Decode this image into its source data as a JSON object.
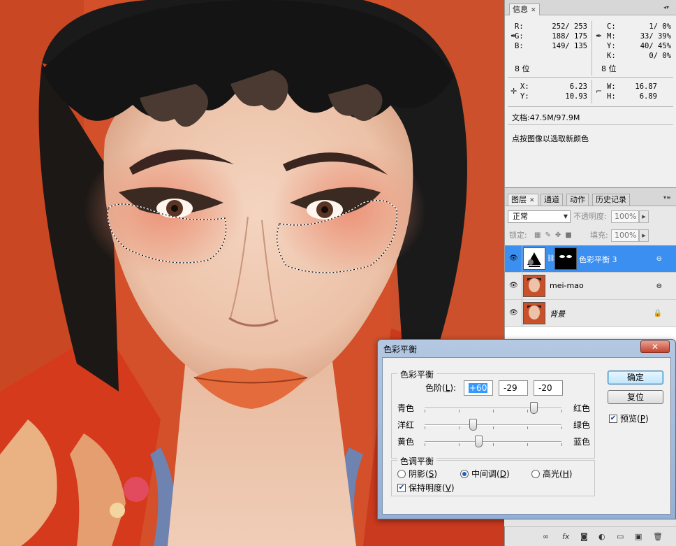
{
  "info_panel": {
    "tab_label": "信息",
    "rgb": {
      "r_label": "R:",
      "r_value": "252/ 253",
      "g_label": "G:",
      "g_value": "188/ 175",
      "b_label": "B:",
      "b_value": "149/ 135",
      "bits": "8 位"
    },
    "cmyk": {
      "c_label": "C:",
      "c_value": "1/ 0%",
      "m_label": "M:",
      "m_value": "33/ 39%",
      "y_label": "Y:",
      "y_value": "40/ 45%",
      "k_label": "K:",
      "k_value": "0/ 0%",
      "bits": "8 位"
    },
    "xy": {
      "x_label": "X:",
      "x_value": "6.23",
      "y_label": "Y:",
      "y_value": "10.93"
    },
    "wh": {
      "w_label": "W:",
      "w_value": "16.87",
      "h_label": "H:",
      "h_value": "6.89"
    },
    "doc": "文档:47.5M/97.9M",
    "hint": "点按图像以选取新颜色"
  },
  "layers_panel": {
    "tabs": [
      "图层",
      "通道",
      "动作",
      "历史记录"
    ],
    "blend_mode": "正常",
    "opacity_label": "不透明度:",
    "opacity_value": "100%",
    "lock_label": "锁定:",
    "fill_label": "填充:",
    "fill_value": "100%",
    "layers": [
      {
        "name": "色彩平衡 3",
        "selected": true
      },
      {
        "name": "mei-mao",
        "selected": false
      },
      {
        "name": "背景",
        "selected": false
      }
    ]
  },
  "dialog": {
    "title": "色彩平衡",
    "close": "✕",
    "balance_group": "色彩平衡",
    "levels_label_a": "色阶(",
    "levels_key": "L",
    "levels_label_b": "):",
    "levels": [
      "+60",
      "-29",
      "-20"
    ],
    "sliders": [
      {
        "left": "青色",
        "right": "红色",
        "value": 60
      },
      {
        "left": "洋红",
        "right": "绿色",
        "value": -29
      },
      {
        "left": "黄色",
        "right": "蓝色",
        "value": -20
      }
    ],
    "tone_group": "色调平衡",
    "shadows_a": "阴影(",
    "shadows_key": "S",
    "shadows_b": ")",
    "midtones_a": "中间调(",
    "midtones_key": "D",
    "midtones_b": ")",
    "highlights_a": "高光(",
    "highlights_key": "H",
    "highlights_b": ")",
    "preserve_a": "保持明度(",
    "preserve_key": "V",
    "preserve_b": ")",
    "ok": "确定",
    "reset": "复位",
    "preview_a": "预览(",
    "preview_key": "P",
    "preview_b": ")",
    "tone_selected": "midtones"
  }
}
